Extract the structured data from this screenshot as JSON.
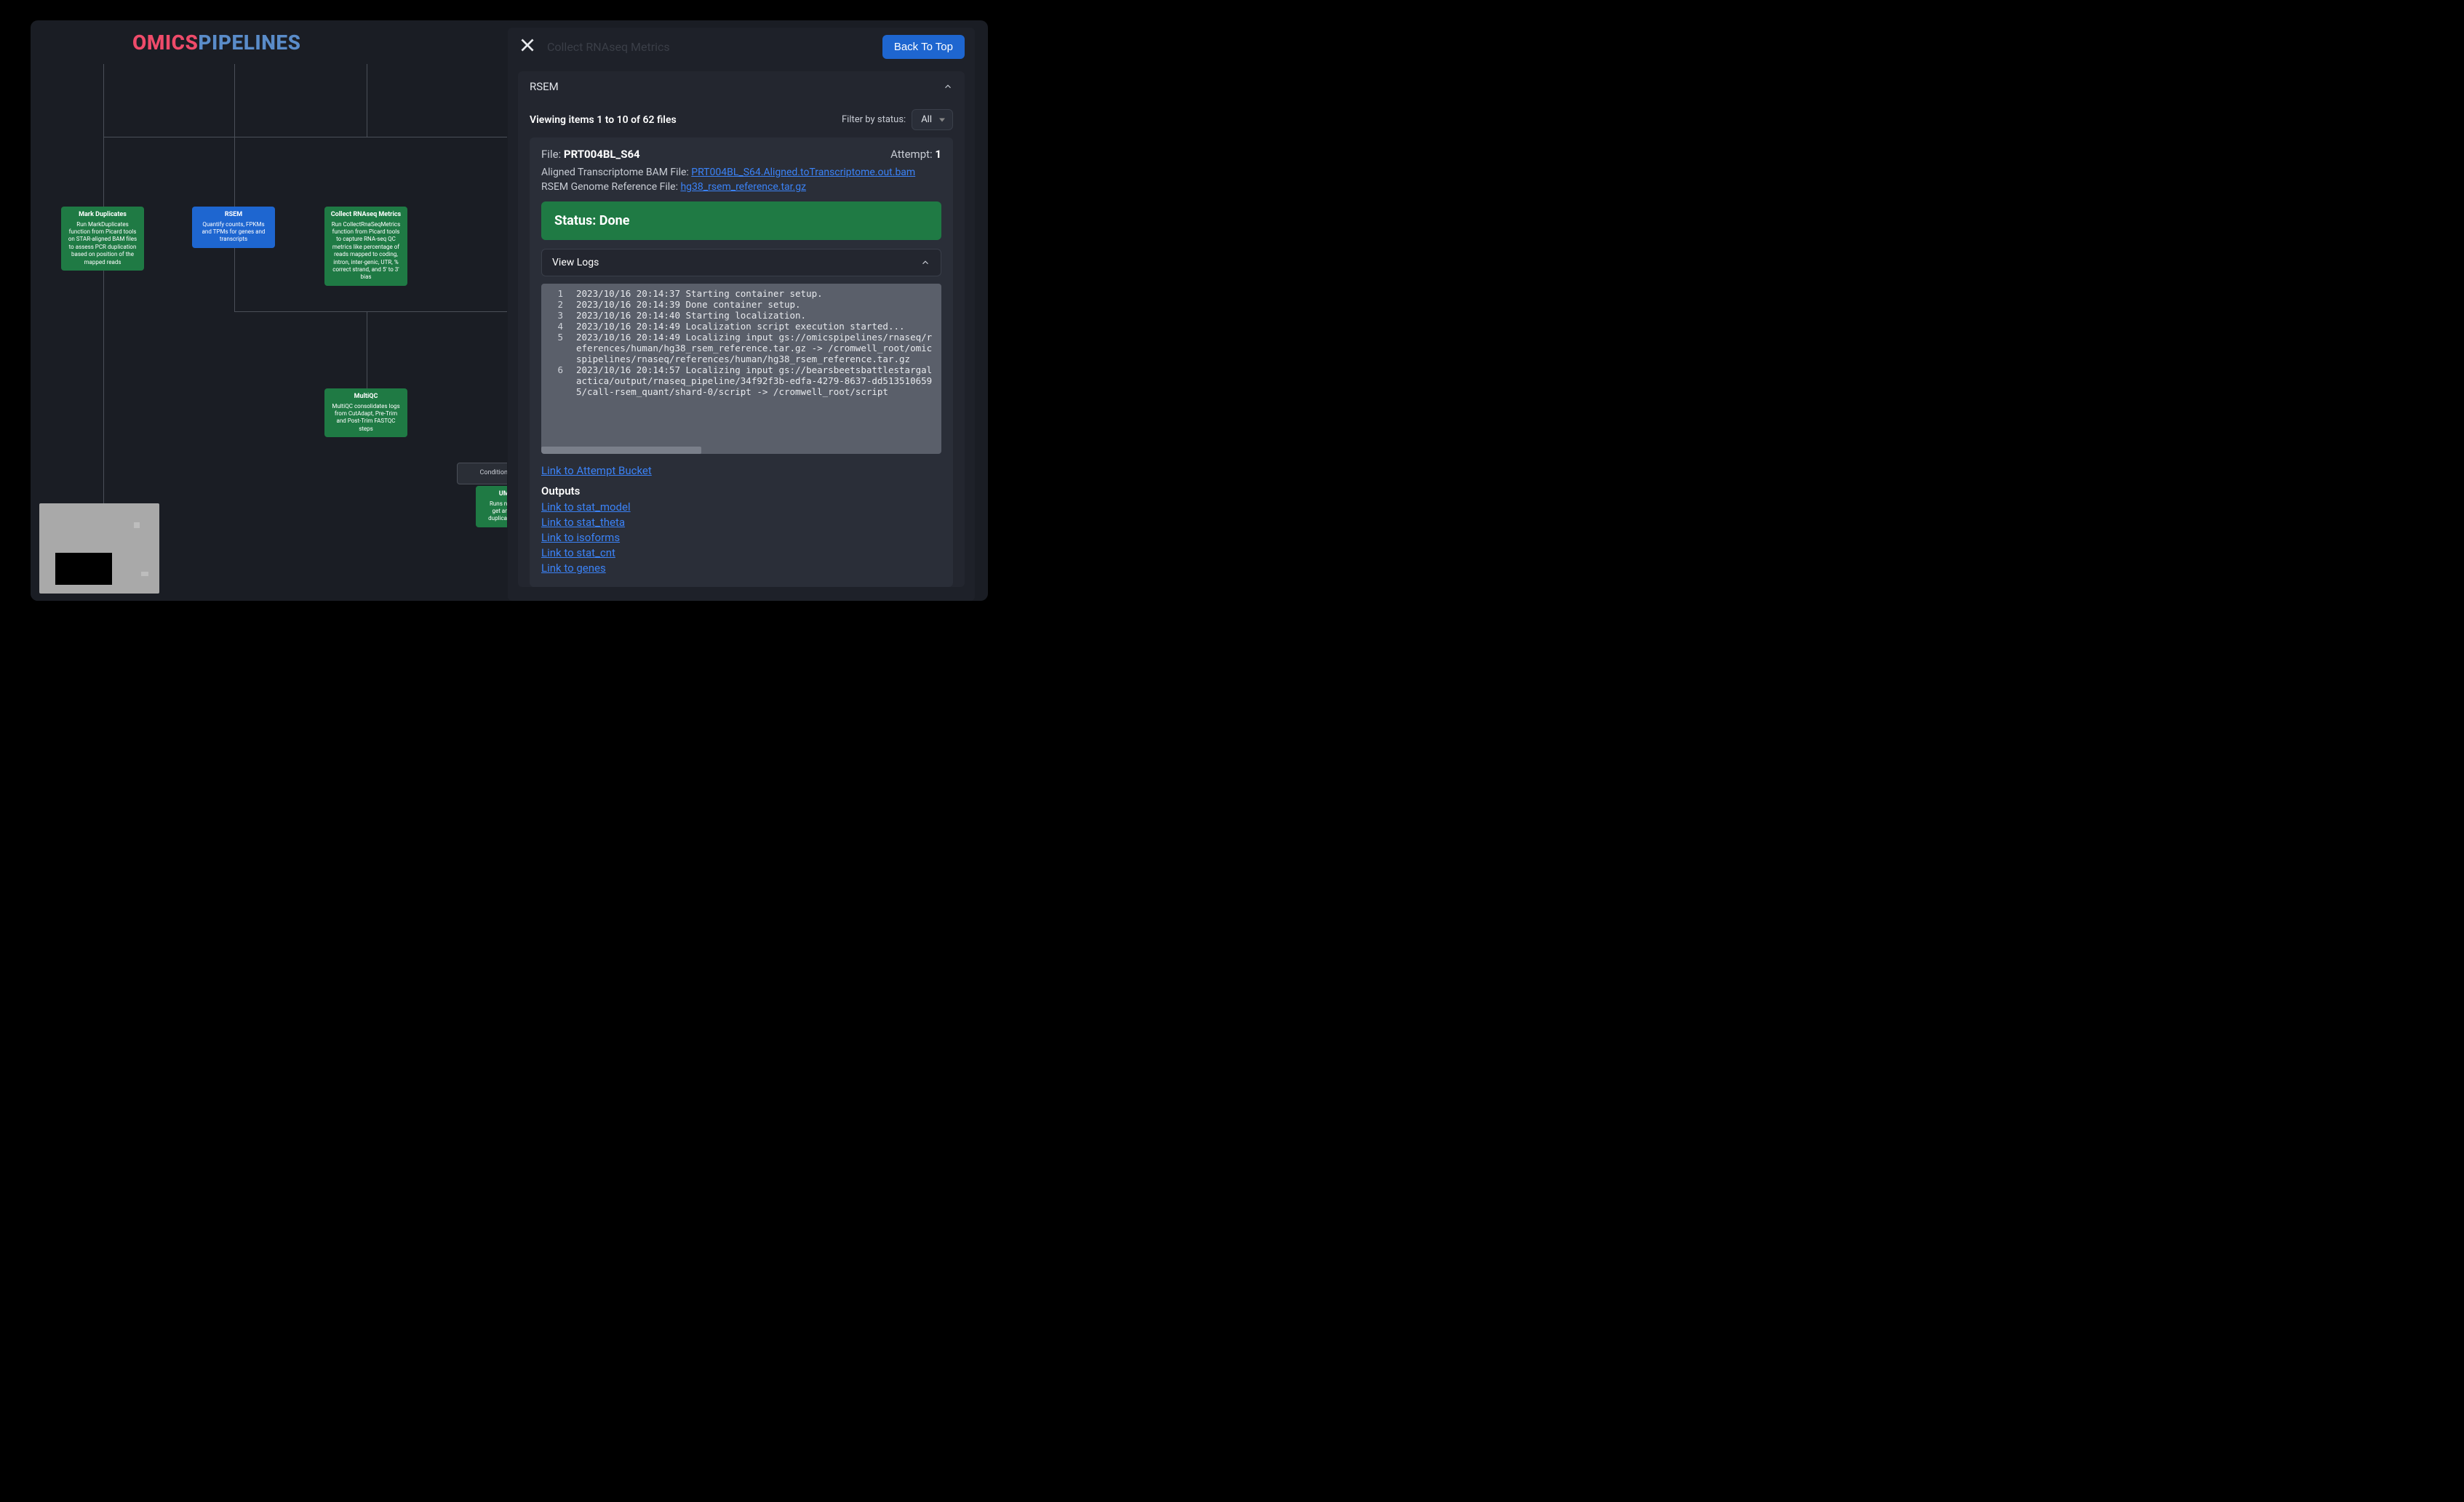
{
  "logo": {
    "part1": "OMICS",
    "part2": "PIPELINES"
  },
  "nodes": {
    "markdup": {
      "title": "Mark Duplicates",
      "desc": "Run MarkDuplicates function from Picard tools on STAR-aligned BAM files to assess PCR duplication based on position of the mapped reads"
    },
    "rsem": {
      "title": "RSEM",
      "desc": "Quantify counts, FPKMs and TPMs for genes and transcripts"
    },
    "collect": {
      "title": "Collect RNAseq Metrics",
      "desc": "Run CollectRnaSeqMetrics function from Picard tools to capture RNA-seq QC metrics like percentage of reads mapped to coding, intron, inter-genic, UTR, % correct strand, and 5' to 3' bias"
    },
    "multiqc": {
      "title": "MultiQC",
      "desc": "MultiQC consolidates logs from CutAdapt, Pre-Trim and Post-Trim FASTQC steps"
    },
    "condgroup": {
      "title": "Conditional Grou"
    },
    "umi": {
      "title": "UMI ",
      "desc": "Runs nudup\nget an est\nduplicates re"
    }
  },
  "panel": {
    "breadcrumb_ghost": "Collect RNAseq Metrics",
    "back_to_top": "Back To Top",
    "section_title": "RSEM",
    "viewing": "Viewing items 1 to 10 of 62 files",
    "filter_label": "Filter by status:",
    "filter_value": "All",
    "file": {
      "file_label": "File: ",
      "file_name": "PRT004BL_S64",
      "attempt_label": "Attempt: ",
      "attempt_num": "1",
      "bam_label": "Aligned Transcriptome BAM File: ",
      "bam_link": "PRT004BL_S64.Aligned.toTranscriptome.out.bam",
      "ref_label": "RSEM Genome Reference File: ",
      "ref_link": "hg38_rsem_reference.tar.gz",
      "status": "Status: Done",
      "view_logs": "View Logs",
      "logs": [
        {
          "n": "1",
          "t": "2023/10/16 20:14:37 Starting container setup."
        },
        {
          "n": "2",
          "t": "2023/10/16 20:14:39 Done container setup."
        },
        {
          "n": "3",
          "t": "2023/10/16 20:14:40 Starting localization."
        },
        {
          "n": "4",
          "t": "2023/10/16 20:14:49 Localization script execution started..."
        },
        {
          "n": "5",
          "t": "2023/10/16 20:14:49 Localizing input gs://omicspipelines/rnaseq/references/human/hg38_rsem_reference.tar.gz -> /cromwell_root/omicspipelines/rnaseq/references/human/hg38_rsem_reference.tar.gz"
        },
        {
          "n": "6",
          "t": "2023/10/16 20:14:57 Localizing input gs://bearsbeetsbattlestargalactica/output/rnaseq_pipeline/34f92f3b-edfa-4279-8637-dd5135106595/call-rsem_quant/shard-0/script -> /cromwell_root/script"
        }
      ],
      "bucket_link": "Link to Attempt Bucket",
      "outputs_head": "Outputs",
      "outputs": [
        "Link to stat_model",
        "Link to stat_theta",
        "Link to isoforms",
        "Link to stat_cnt",
        "Link to genes"
      ]
    }
  }
}
